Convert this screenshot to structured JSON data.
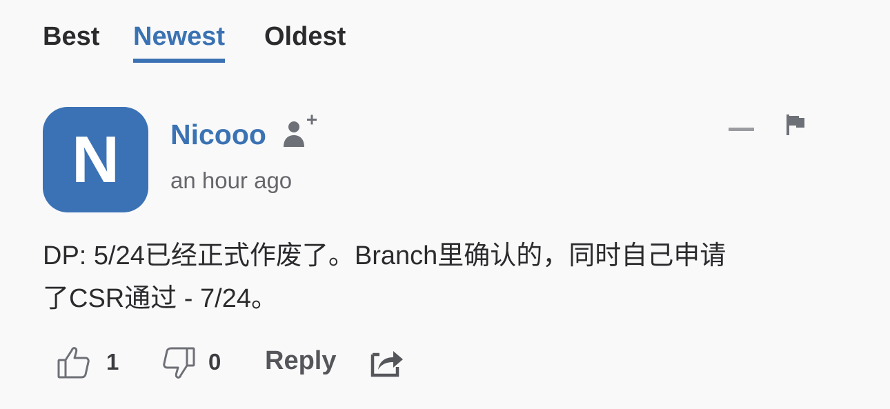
{
  "tabs": [
    {
      "label": "Best",
      "active": false
    },
    {
      "label": "Newest",
      "active": true
    },
    {
      "label": "Oldest",
      "active": false
    }
  ],
  "comment": {
    "avatar_letter": "N",
    "author": "Nicooo",
    "timestamp": "an hour ago",
    "text_line1": "DP: 5/24已经正式作废了。Branch里确认的，同时自己申请",
    "text_line2": "了CSR通过 - 7/24。",
    "upvotes": "1",
    "downvotes": "0",
    "reply_label": "Reply"
  },
  "icons": {
    "follow": "follow-user-icon",
    "collapse": "collapse-icon",
    "flag": "flag-icon",
    "upvote": "thumbs-up-icon",
    "downvote": "thumbs-down-icon",
    "share": "share-icon"
  },
  "colors": {
    "accent": "#3a72b3",
    "avatar_bg": "#3b72b5",
    "text": "#2b2b2e",
    "muted": "#66676b",
    "icon": "#6e7077",
    "background": "#f9f9fa"
  }
}
